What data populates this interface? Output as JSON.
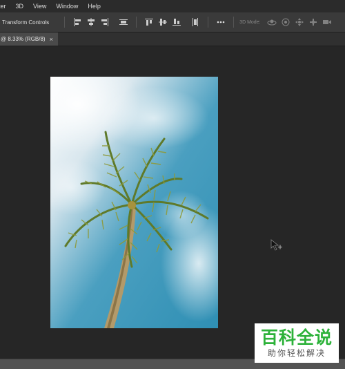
{
  "menubar": {
    "items": [
      "ter",
      "3D",
      "View",
      "Window",
      "Help"
    ]
  },
  "options_bar": {
    "transform_controls_label": "Transform Controls",
    "mode_3d_label": "3D Mode:",
    "icons": [
      "align-left-icon",
      "align-center-icon",
      "align-right-icon",
      "distribute-icon",
      "align-top-icon",
      "align-middle-icon",
      "align-bottom-icon",
      "distribute-vertical-icon",
      "more-icon",
      "orbit-3d-icon",
      "roll-3d-icon",
      "pan-3d-icon",
      "slide-3d-icon",
      "camera-3d-icon"
    ]
  },
  "document_tab": {
    "title": "@ 8.33% (RGB/8)",
    "close_glyph": "×"
  },
  "canvas": {
    "image_description": "palm tree against blue sky"
  },
  "watermark": {
    "title": "百科全说",
    "subtitle": "助你轻松解决",
    "color": "#2db23a"
  }
}
